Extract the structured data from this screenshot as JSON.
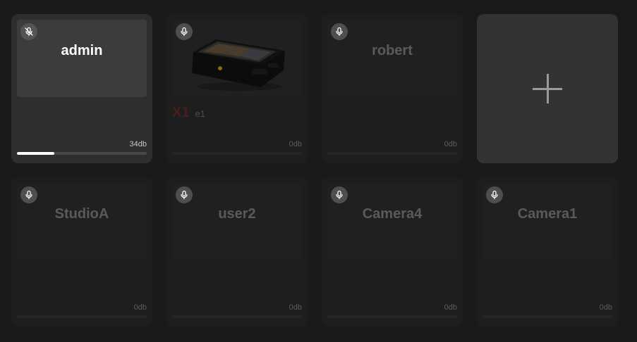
{
  "colors": {
    "background": "#1a1a1a",
    "tile_active": "#2e2e2e",
    "tile_inactive": "#1e1e1e",
    "tile_add": "#333333",
    "meter_fill": "#ffffff",
    "model_accent": "#4a1c1c"
  },
  "tiles": [
    {
      "name": "admin",
      "level": "34db",
      "level_fraction": 0.29,
      "mic_icon": "mic-muted-icon",
      "active": true
    },
    {
      "name": "",
      "model": "X1",
      "subname": "e1",
      "level": "0db",
      "level_fraction": 0,
      "mic_icon": "mic-icon",
      "thumbnail": "camera-monitor-image"
    },
    {
      "name": "robert",
      "level": "0db",
      "level_fraction": 0,
      "mic_icon": "mic-icon"
    },
    {
      "type": "add",
      "icon": "plus-icon"
    },
    {
      "name": "StudioA",
      "level": "0db",
      "level_fraction": 0,
      "mic_icon": "mic-icon"
    },
    {
      "name": "user2",
      "level": "0db",
      "level_fraction": 0,
      "mic_icon": "mic-icon"
    },
    {
      "name": "Camera4",
      "level": "0db",
      "level_fraction": 0,
      "mic_icon": "mic-icon"
    },
    {
      "name": "Camera1",
      "level": "0db",
      "level_fraction": 0,
      "mic_icon": "mic-icon"
    }
  ]
}
